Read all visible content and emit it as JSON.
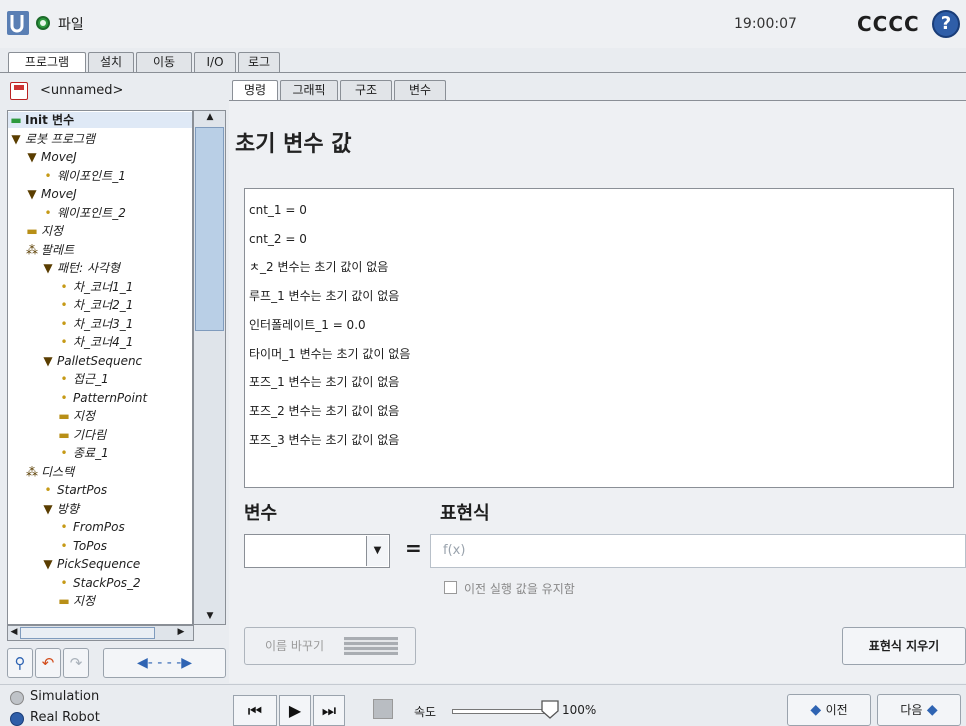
{
  "header": {
    "menu_label": "파일",
    "time": "19:00:07",
    "robot_name": "CCCC",
    "help_glyph": "?"
  },
  "main_tabs": [
    "프로그램",
    "설치",
    "이동",
    "I/O",
    "로그"
  ],
  "program": {
    "filename": "<unnamed>"
  },
  "tree": [
    {
      "label": "Init 변수",
      "depth": 0,
      "glyph": "▬",
      "style": "sel"
    },
    {
      "label": "로봇 프로그램",
      "depth": 0,
      "glyph": "▼"
    },
    {
      "label": "MoveJ",
      "depth": 1,
      "glyph": "▼"
    },
    {
      "label": "웨이포인트_1",
      "depth": 2,
      "glyph": "•"
    },
    {
      "label": "MoveJ",
      "depth": 1,
      "glyph": "▼"
    },
    {
      "label": "웨이포인트_2",
      "depth": 2,
      "glyph": "•"
    },
    {
      "label": "지정",
      "depth": 1,
      "glyph": "▬"
    },
    {
      "label": "팔레트",
      "depth": 1,
      "glyph": "⁂"
    },
    {
      "label": "패턴: 사각형",
      "depth": 2,
      "glyph": "▼"
    },
    {
      "label": "차_코너1_1",
      "depth": 3,
      "glyph": "•"
    },
    {
      "label": "차_코너2_1",
      "depth": 3,
      "glyph": "•"
    },
    {
      "label": "차_코너3_1",
      "depth": 3,
      "glyph": "•"
    },
    {
      "label": "차_코너4_1",
      "depth": 3,
      "glyph": "•"
    },
    {
      "label": "PalletSequenc",
      "depth": 2,
      "glyph": "▼"
    },
    {
      "label": "접근_1",
      "depth": 3,
      "glyph": "•"
    },
    {
      "label": "PatternPoint",
      "depth": 3,
      "glyph": "•"
    },
    {
      "label": "지정",
      "depth": 3,
      "glyph": "▬"
    },
    {
      "label": "기다림",
      "depth": 3,
      "glyph": "▬"
    },
    {
      "label": "종료_1",
      "depth": 3,
      "glyph": "•"
    },
    {
      "label": "디스택",
      "depth": 1,
      "glyph": "⁂"
    },
    {
      "label": "StartPos",
      "depth": 2,
      "glyph": "•"
    },
    {
      "label": "방향",
      "depth": 2,
      "glyph": "▼"
    },
    {
      "label": "FromPos",
      "depth": 3,
      "glyph": "•"
    },
    {
      "label": "ToPos",
      "depth": 3,
      "glyph": "•"
    },
    {
      "label": "PickSequence",
      "depth": 2,
      "glyph": "▼"
    },
    {
      "label": "StackPos_2",
      "depth": 3,
      "glyph": "•"
    },
    {
      "label": "지정",
      "depth": 3,
      "glyph": "▬"
    }
  ],
  "sub_tabs": [
    "명령",
    "그래픽",
    "구조",
    "변수"
  ],
  "panel": {
    "title": "초기 변수 값"
  },
  "variables": [
    "cnt_1 = 0",
    "cnt_2 = 0",
    "ㅊ_2 변수는 초기 값이 없음",
    "루프_1 변수는 초기 값이 없음",
    "인터폴레이트_1 = 0.0",
    "타이머_1 변수는 초기 값이 없음",
    "포즈_1 변수는 초기 값이 없음",
    "포즈_2 변수는 초기 값이 없음",
    "포즈_3 변수는 초기 값이 없음"
  ],
  "form": {
    "var_label": "변수",
    "expr_label": "표현식",
    "eq": "=",
    "expr_placeholder": "f(x)",
    "keep_value_label": "이전 실행 값을 유지함",
    "rename_label": "이름 바꾸기",
    "clear_expr_label": "표현식 지우기"
  },
  "bottom": {
    "modes": [
      "Simulation",
      "Real Robot"
    ],
    "speed_label": "속도",
    "speed_value": "100%",
    "speed_fraction": 1.0,
    "prev_label": "이전",
    "next_label": "다음"
  },
  "colors": {
    "accent": "#2f64b3",
    "status_ok": "#2e9a3f",
    "selection": "#dfe9f6"
  }
}
